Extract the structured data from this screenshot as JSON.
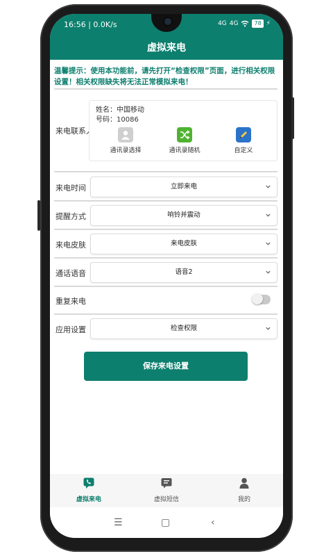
{
  "status_bar": {
    "time": "16:56 | 0.0K/s",
    "signal_1": "4G",
    "signal_2": "4G",
    "battery": "78"
  },
  "header": {
    "title": "虚拟来电"
  },
  "tip": "温馨提示：使用本功能前，请先打开“检查权限”页面，进行相关权限设置！相关权限缺失将无法正常模拟来电！",
  "contact": {
    "label": "来电联系人",
    "name_line": "姓名：中国移动",
    "number_line": "号码：10086",
    "options": [
      {
        "label": "通讯录选择",
        "icon": "contacts-book-icon"
      },
      {
        "label": "通讯录随机",
        "icon": "shuffle-icon"
      },
      {
        "label": "自定义",
        "icon": "edit-pen-icon"
      }
    ]
  },
  "settings": [
    {
      "label": "来电时间",
      "value": "立即来电"
    },
    {
      "label": "提醒方式",
      "value": "响铃并震动"
    },
    {
      "label": "来电皮肤",
      "value": "来电皮肤"
    },
    {
      "label": "通话语音",
      "value": "语音2"
    }
  ],
  "repeat": {
    "label": "重复来电",
    "enabled": false
  },
  "app_settings": {
    "label": "应用设置",
    "value": "检查权限"
  },
  "save_button": "保存来电设置",
  "tabs": [
    {
      "label": "虚拟来电",
      "icon": "phone-chat-icon",
      "active": true
    },
    {
      "label": "虚拟短信",
      "icon": "sms-icon",
      "active": false
    },
    {
      "label": "我的",
      "icon": "person-icon",
      "active": false
    }
  ],
  "colors": {
    "primary": "#0d7f6e",
    "inactive_tab": "#555555"
  }
}
